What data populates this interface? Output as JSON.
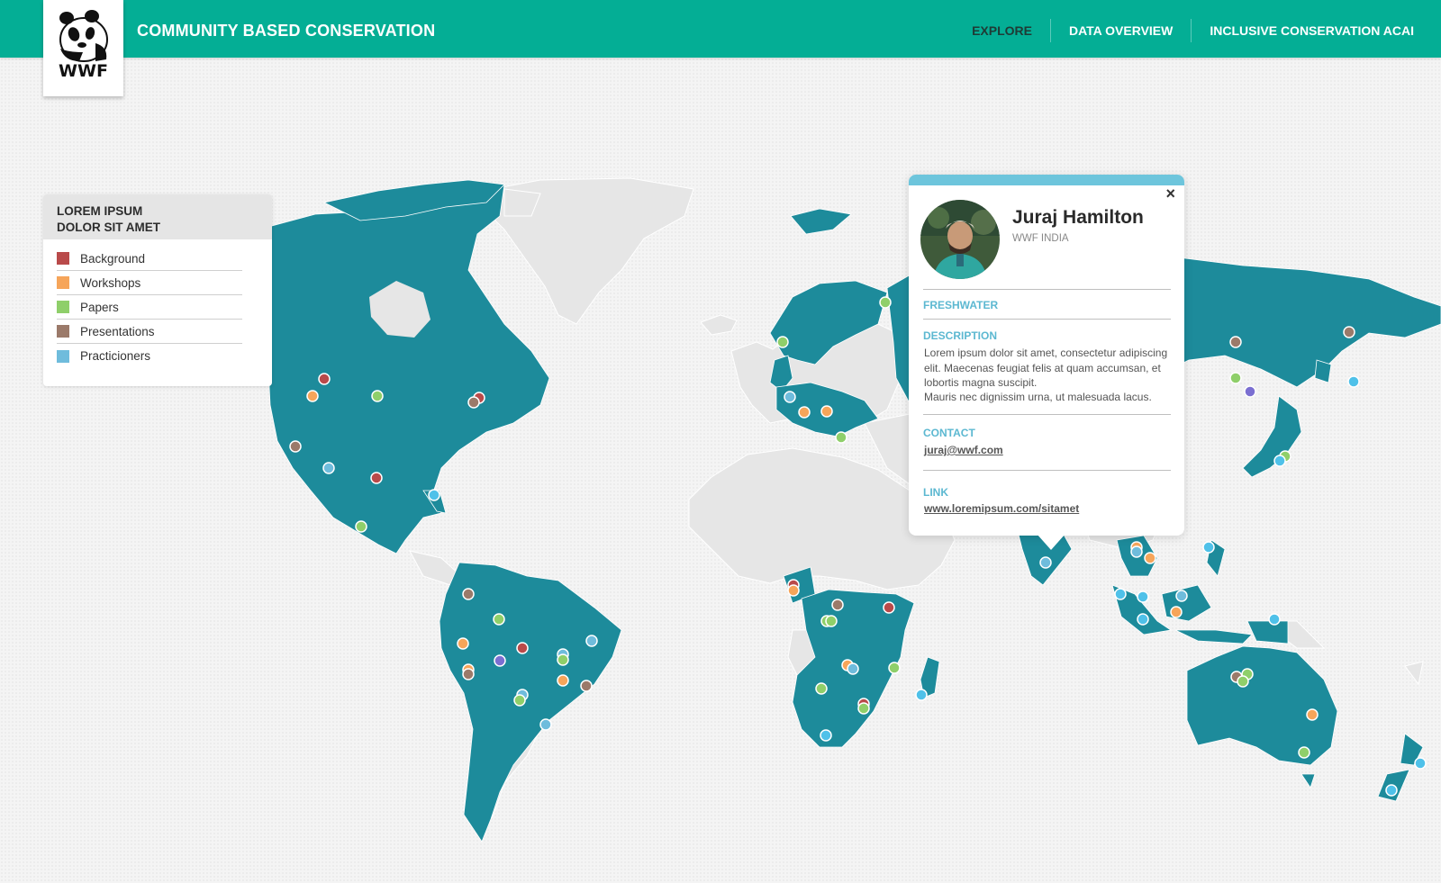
{
  "header": {
    "brand": "WWF",
    "title": "COMMUNITY BASED CONSERVATION",
    "nav": [
      {
        "label": "EXPLORE",
        "active": true
      },
      {
        "label": "DATA OVERVIEW",
        "active": false
      },
      {
        "label": "INCLUSIVE CONSERVATION ACAI",
        "active": false
      }
    ],
    "colors": {
      "bar": "#04ae95",
      "active": "#1f3b35"
    }
  },
  "legend": {
    "title_line1": "LOREM IPSUM",
    "title_line2": "DOLOR SIT AMET",
    "items": [
      {
        "label": "Background",
        "color": "#b94a4a"
      },
      {
        "label": "Workshops",
        "color": "#f6a55a"
      },
      {
        "label": "Papers",
        "color": "#8fcf6a"
      },
      {
        "label": "Presentations",
        "color": "#9b7a6a"
      },
      {
        "label": "Practicioners",
        "color": "#6fbcdc"
      }
    ]
  },
  "profile_card": {
    "name": "Juraj Hamilton",
    "org": "WWF INDIA",
    "category": "FRESHWATER",
    "description_label": "DESCRIPTION",
    "description": "Lorem ipsum dolor sit amet, consectetur adipiscing elit. Maecenas feugiat felis at quam accumsan, et lobortis magna suscipit.",
    "description_2": "Mauris nec dignissim urna, ut malesuada lacus.",
    "contact_label": "CONTACT",
    "contact": "juraj@wwf.com",
    "link_label": "LINK",
    "link": "www.loremipsum.com/sitamet",
    "close_icon": "×",
    "accent": "#5cb8d1"
  },
  "map": {
    "land_active": "#1d8b9b",
    "land_inactive": "#e6e6e6",
    "marker_colors": {
      "red": "#b94a4a",
      "orange": "#f6a55a",
      "green": "#8fcf6a",
      "brown": "#9b7a6a",
      "blue": "#6fbcdc",
      "purple": "#7b6fd1"
    }
  }
}
